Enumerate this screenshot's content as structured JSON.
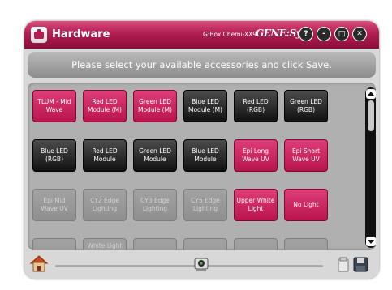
{
  "titlebar": {
    "title": "Hardware",
    "device": "G:Box Chemi-XX9",
    "brand": "GENE:Sys",
    "help_label": "?",
    "minimize_label": "-",
    "maximize_label": "□",
    "close_label": "✕"
  },
  "banner": {
    "message": "Please select your available accessories and click Save."
  },
  "tiles": [
    {
      "label": "TLUM - Mid Wave",
      "state": "selected"
    },
    {
      "label": "Red LED Module (M)",
      "state": "selected"
    },
    {
      "label": "Green LED Module (M)",
      "state": "selected"
    },
    {
      "label": "Blue LED Module (M)",
      "state": "available"
    },
    {
      "label": "Red LED (RGB)",
      "state": "available"
    },
    {
      "label": "Green LED (RGB)",
      "state": "available"
    },
    {
      "label": "Blue LED (RGB)",
      "state": "available"
    },
    {
      "label": "Red LED Module",
      "state": "available"
    },
    {
      "label": "Green LED Module",
      "state": "available"
    },
    {
      "label": "Blue LED Module",
      "state": "available"
    },
    {
      "label": "Epi Long Wave UV",
      "state": "selected"
    },
    {
      "label": "Epi Short Wave UV",
      "state": "selected"
    },
    {
      "label": "Epi Mid Wave UV",
      "state": "disabled"
    },
    {
      "label": "CY2 Edge Lighting",
      "state": "disabled"
    },
    {
      "label": "CY3 Edge Lighting",
      "state": "disabled"
    },
    {
      "label": "CY5 Edge Lighting",
      "state": "disabled"
    },
    {
      "label": "Upper White Light",
      "state": "selected"
    },
    {
      "label": "No Light",
      "state": "selected"
    },
    {
      "label": "",
      "state": "disabled"
    },
    {
      "label": "White Light",
      "state": "disabled"
    },
    {
      "label": "",
      "state": "disabled"
    },
    {
      "label": "",
      "state": "disabled"
    },
    {
      "label": "",
      "state": "disabled"
    },
    {
      "label": "",
      "state": "disabled"
    }
  ],
  "footer": {
    "icons": [
      "home-icon",
      "camera-icon",
      "save-icon"
    ]
  },
  "colors": {
    "accent": "#b01e52",
    "selected_tile": "#c8205c",
    "available_tile": "#1a1a1a",
    "disabled_tile": "#9a9a9a"
  }
}
